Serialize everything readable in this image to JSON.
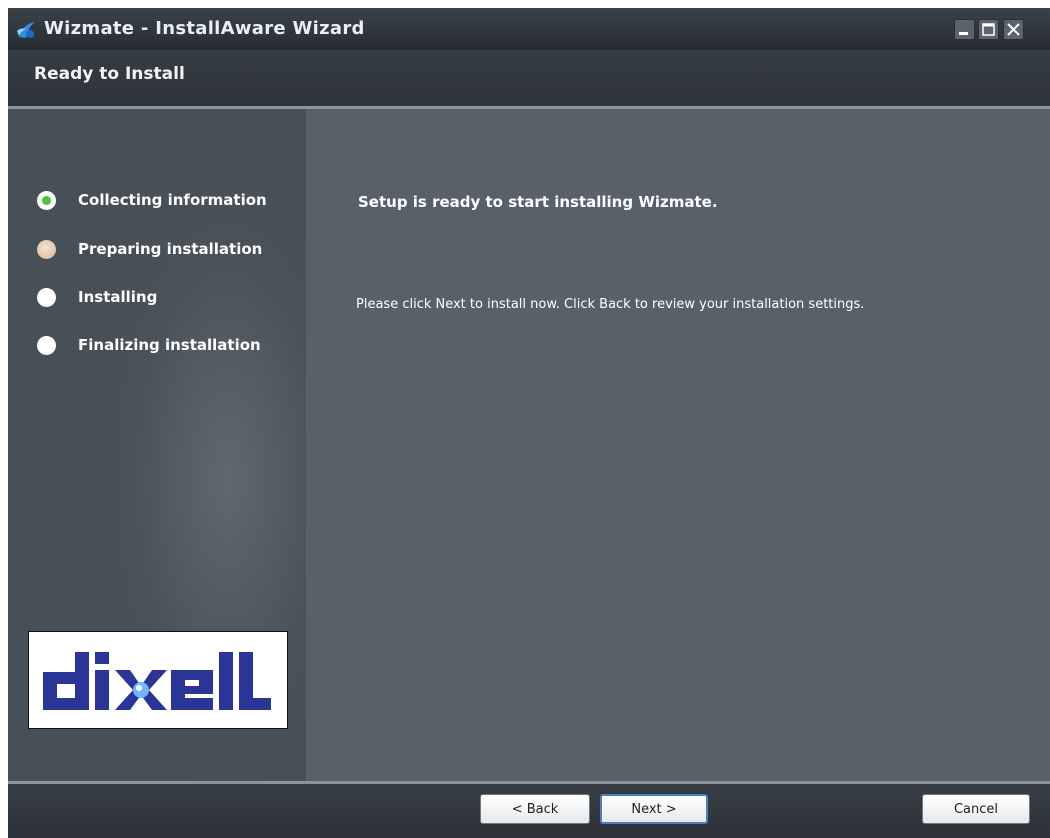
{
  "window": {
    "title": "Wizmate - InstallAware Wizard",
    "icons": {
      "app": "installaware-icon",
      "minimize": "minimize-icon",
      "maximize": "maximize-icon",
      "close": "close-icon"
    }
  },
  "header": {
    "title": "Ready to Install"
  },
  "steps": [
    {
      "label": "Collecting information",
      "state": "done"
    },
    {
      "label": "Preparing installation",
      "state": "current"
    },
    {
      "label": "Installing",
      "state": "pending"
    },
    {
      "label": "Finalizing installation",
      "state": "pending"
    }
  ],
  "logo": {
    "text": "dixell",
    "color": "#2a3596"
  },
  "content": {
    "heading": "Setup is ready to start installing Wizmate.",
    "instruction": "Please click Next to install now. Click Back to review your installation settings."
  },
  "buttons": {
    "back": "< Back",
    "next": "Next >",
    "cancel": "Cancel"
  },
  "colors": {
    "step_done": "#4ec23c",
    "step_current": "#d4b699",
    "default_button_border": "#4e7fbd"
  }
}
